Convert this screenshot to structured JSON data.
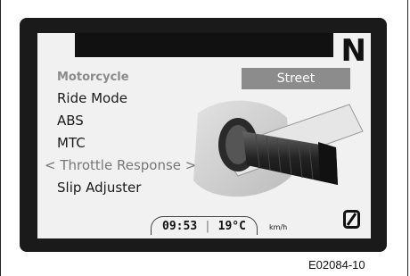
{
  "display": {
    "gear": "N",
    "mode_value": "Street"
  },
  "menu": {
    "header": "Motorcycle",
    "items": [
      {
        "label": "Ride Mode"
      },
      {
        "label": "ABS"
      },
      {
        "label": "MTC"
      },
      {
        "label": "Throttle Response",
        "selected": true
      },
      {
        "label": "Slip Adjuster"
      }
    ],
    "selection_arrows": {
      "left": "<",
      "right": ">"
    }
  },
  "status": {
    "time": "09:53",
    "separator": "|",
    "temperature": "19°C",
    "speed_unit": "km/h"
  },
  "figure": {
    "code": "E02084-10"
  },
  "icons": {
    "gear_indicator": "gear-indicator",
    "illustration": "throttle-grip-illustration",
    "abs": "zero-slash-icon"
  }
}
